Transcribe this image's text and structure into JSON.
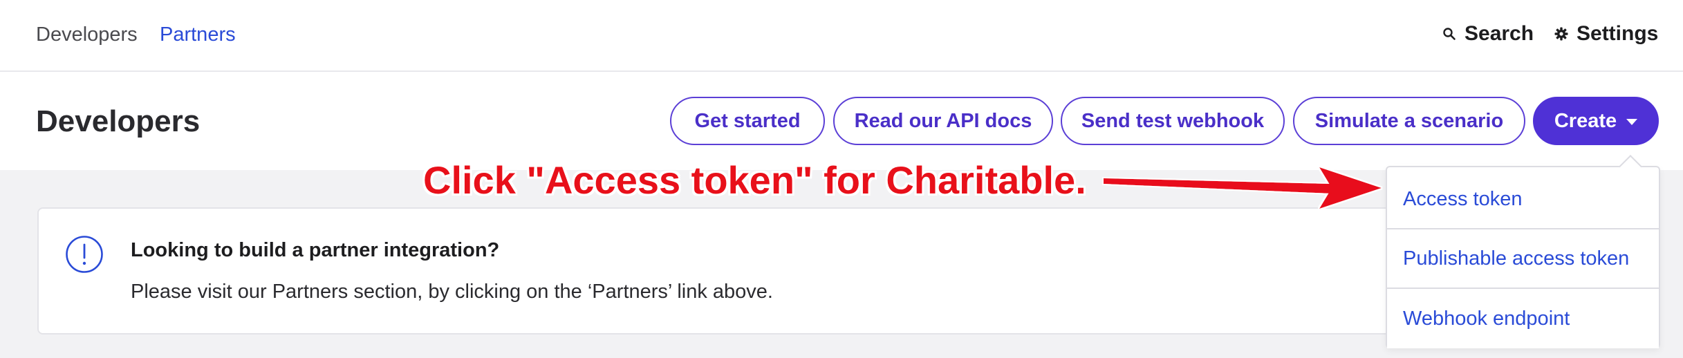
{
  "topnav": {
    "links": [
      "Developers",
      "Partners"
    ],
    "search_label": "Search",
    "settings_label": "Settings"
  },
  "header": {
    "title": "Developers",
    "buttons": {
      "get_started": "Get started",
      "api_docs": "Read our API docs",
      "test_webhook": "Send test webhook",
      "simulate": "Simulate a scenario",
      "create": "Create"
    }
  },
  "banner": {
    "title": "Looking to build a partner integration?",
    "body": "Please visit our Partners section, by clicking on the ‘Partners’ link above."
  },
  "dropdown": {
    "items": [
      "Access token",
      "Publishable access token",
      "Webhook endpoint"
    ]
  },
  "annotation": {
    "text": "Click \"Access token\" for Charitable."
  },
  "colors": {
    "accent": "#4f31d6",
    "link": "#2a4bd7",
    "annotation": "#e8101a"
  },
  "icons": {
    "search": "search-icon",
    "settings": "gear-icon",
    "info": "info-icon",
    "create_caret": "chevron-down-icon"
  }
}
